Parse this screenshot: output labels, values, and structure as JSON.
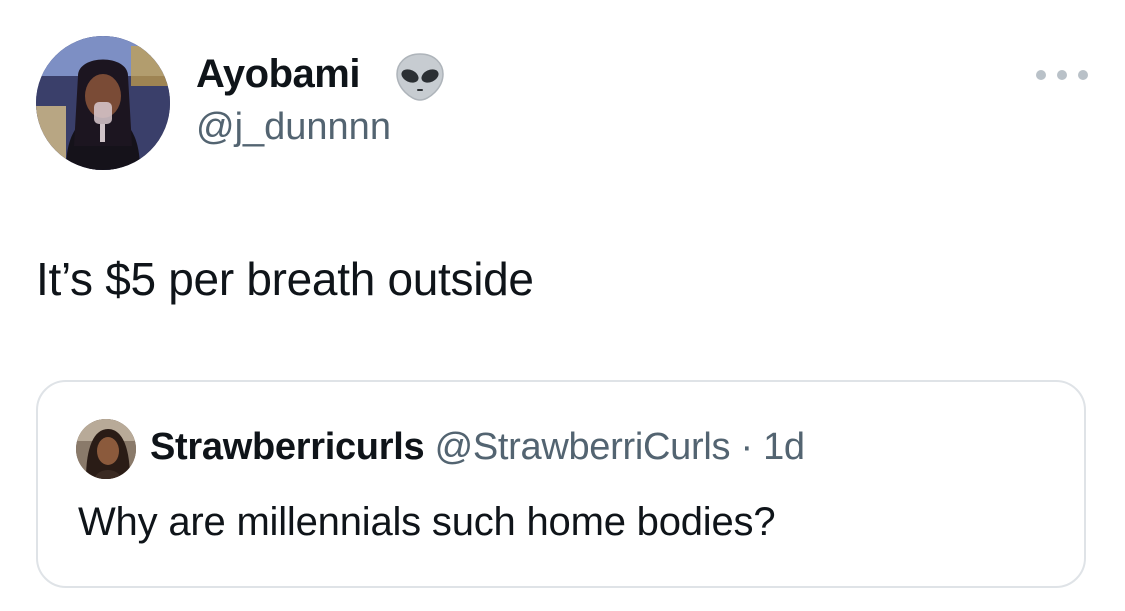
{
  "tweet": {
    "author": {
      "display_name": "Ayobami",
      "handle": "@j_dunnnn",
      "name_emoji_icon": "alien-emoji-icon",
      "avatar_icon": "profile-photo"
    },
    "more_icon": "ellipsis-icon",
    "text": "It’s $5 per breath outside"
  },
  "quote": {
    "author": {
      "display_name": "Strawberricurls",
      "handle": "@StrawberriCurls",
      "avatar_icon": "profile-photo"
    },
    "separator": "·",
    "time": "1d",
    "text": "Why are millennials such home bodies?"
  },
  "colors": {
    "text_primary": "#0f1419",
    "text_secondary": "#536471",
    "border": "#dfe3e7",
    "more_dots": "#b9c1c8"
  }
}
